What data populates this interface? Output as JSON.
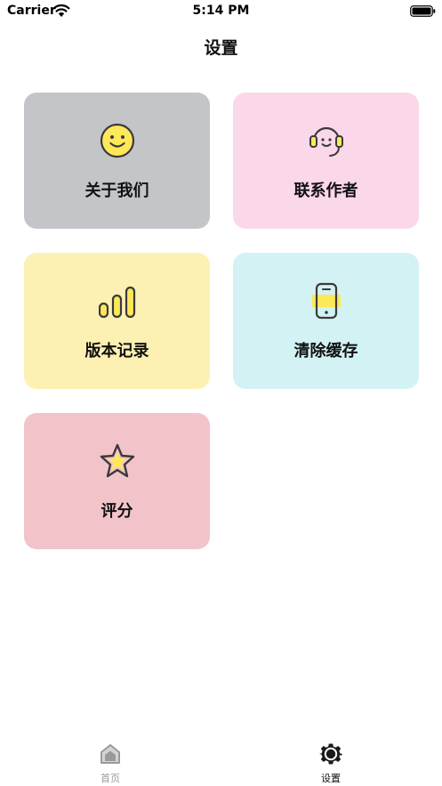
{
  "status_bar": {
    "carrier": "Carrier",
    "time": "5:14 PM",
    "wifi_icon": "wifi-icon",
    "battery_icon": "battery-full-icon"
  },
  "nav": {
    "title": "设置"
  },
  "cards": [
    {
      "label": "关于我们",
      "icon": "smiley-face-icon",
      "color": "#c4c5c9"
    },
    {
      "label": "联系作者",
      "icon": "headset-icon",
      "color": "#fbd7ea"
    },
    {
      "label": "版本记录",
      "icon": "signal-bars-icon",
      "color": "#fdf0b3"
    },
    {
      "label": "清除缓存",
      "icon": "phone-icon",
      "color": "#d3f2f4"
    },
    {
      "label": "评分",
      "icon": "star-icon",
      "color": "#f2c4ca"
    }
  ],
  "tab_bar": {
    "items": [
      {
        "label": "首页",
        "icon": "home-icon",
        "active": false
      },
      {
        "label": "设置",
        "icon": "gear-icon",
        "active": true
      }
    ]
  },
  "colors": {
    "icon_yellow": "#fde85a",
    "icon_stroke": "#3a3a3a"
  }
}
